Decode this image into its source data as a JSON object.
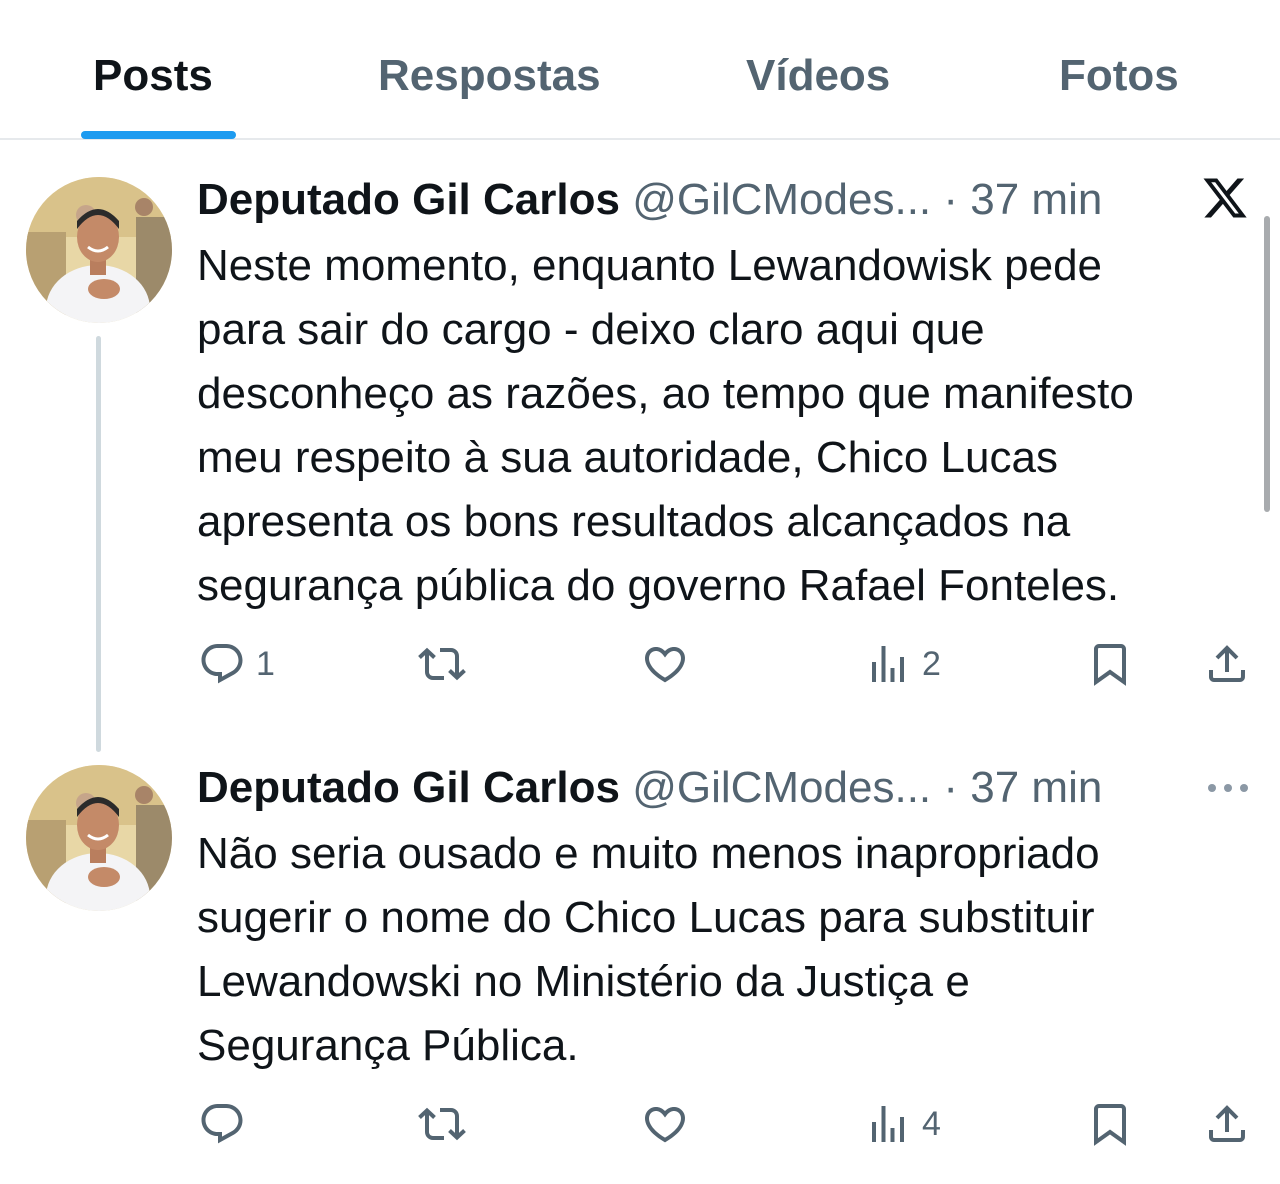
{
  "tabs": [
    {
      "label": "Posts",
      "active": true
    },
    {
      "label": "Respostas",
      "active": false
    },
    {
      "label": "Vídeos",
      "active": false
    },
    {
      "label": "Fotos",
      "active": false
    }
  ],
  "tweets": [
    {
      "author": "Deputado Gil Carlos",
      "handle": "@GilCModes...",
      "separator": " · ",
      "time": "37 min",
      "corner_icon": "x-logo-icon",
      "text_lines": [
        "Neste momento, enquanto Lewandowisk pede",
        "para sair do cargo - deixo claro aqui que",
        "desconheço as razões, ao tempo que manifesto",
        "meu respeito à sua autoridade, Chico Lucas",
        "apresenta os bons resultados alcançados na",
        "segurança pública do governo Rafael Fonteles."
      ],
      "replies": "1",
      "retweets": "",
      "likes": "",
      "views": "2"
    },
    {
      "author": "Deputado Gil Carlos",
      "handle": "@GilCModes...",
      "separator": " · ",
      "time": "37 min",
      "corner_icon": "more-options-icon",
      "text_lines": [
        "Não seria ousado e muito menos inapropriado",
        "sugerir o nome do Chico Lucas para substituir",
        "Lewandowski no Ministério da Justiça e",
        "Segurança Pública."
      ],
      "replies": "",
      "retweets": "",
      "likes": "",
      "views": "4"
    }
  ],
  "colors": {
    "accent": "#1d9bf0",
    "text_primary": "#0f1419",
    "text_secondary": "#536471",
    "divider": "#e6e9ec",
    "thread_line": "#cfd9de"
  }
}
